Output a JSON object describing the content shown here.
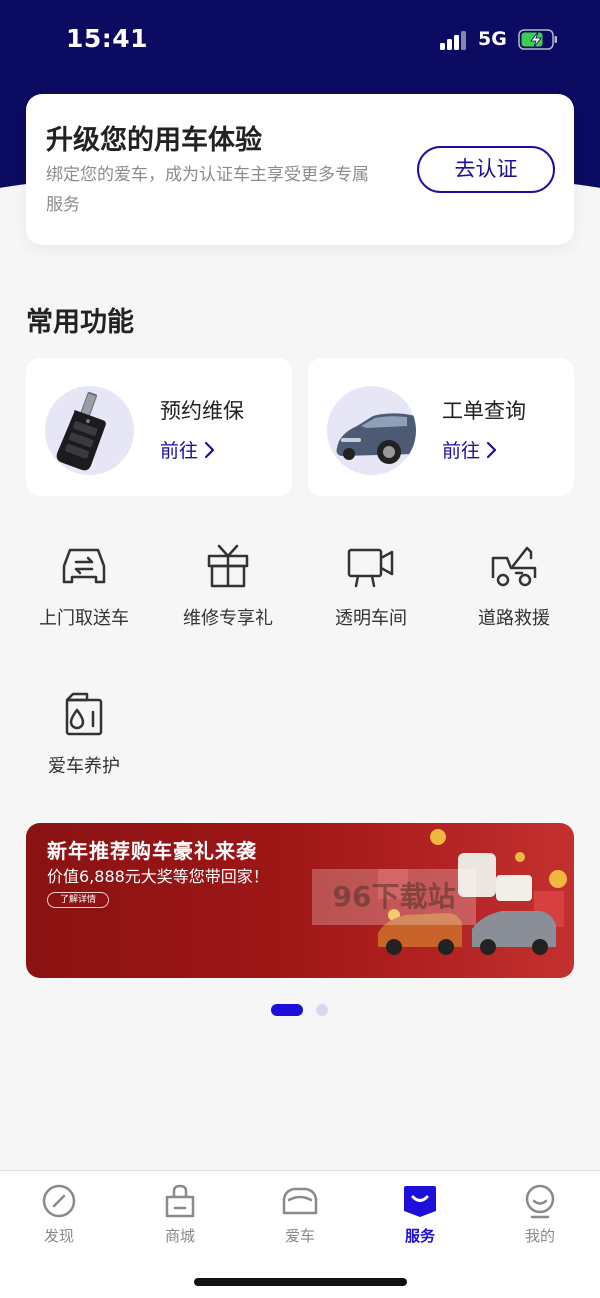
{
  "status_bar": {
    "time": "15:41",
    "network": "5G"
  },
  "verify_card": {
    "title": "升级您的用车体验",
    "description": "绑定您的爱车，成为认证车主享受更多专属服务",
    "button_label": "去认证"
  },
  "section_title": "常用功能",
  "feature_cards": [
    {
      "name": "预约维保",
      "link": "前往"
    },
    {
      "name": "工单查询",
      "link": "前往"
    }
  ],
  "grid_items": [
    {
      "label": "上门取送车",
      "icon": "car-swap-icon"
    },
    {
      "label": "维修专享礼",
      "icon": "gift-icon"
    },
    {
      "label": "透明车间",
      "icon": "camera-icon"
    },
    {
      "label": "道路救援",
      "icon": "tow-truck-icon"
    },
    {
      "label": "爱车养护",
      "icon": "oil-icon"
    }
  ],
  "banner": {
    "title": "新年推荐购车豪礼来袭",
    "subtitle": "价值6,888元大奖等您带回家！",
    "button_label": "了解详情",
    "watermark": "96下载站"
  },
  "pagination": {
    "current": 1,
    "total": 2
  },
  "tabbar": {
    "active": "服务",
    "tabs": [
      {
        "label": "发现",
        "icon": "compass-icon"
      },
      {
        "label": "商城",
        "icon": "shopping-bag-icon"
      },
      {
        "label": "爱车",
        "icon": "car-icon"
      },
      {
        "label": "服务",
        "icon": "service-icon"
      },
      {
        "label": "我的",
        "icon": "profile-icon"
      }
    ]
  },
  "colors": {
    "primary": "#1d0f9e",
    "active_tab": "#1d0fd9",
    "header_bg": "#0b0b62",
    "banner_bg": "#9d1616"
  }
}
